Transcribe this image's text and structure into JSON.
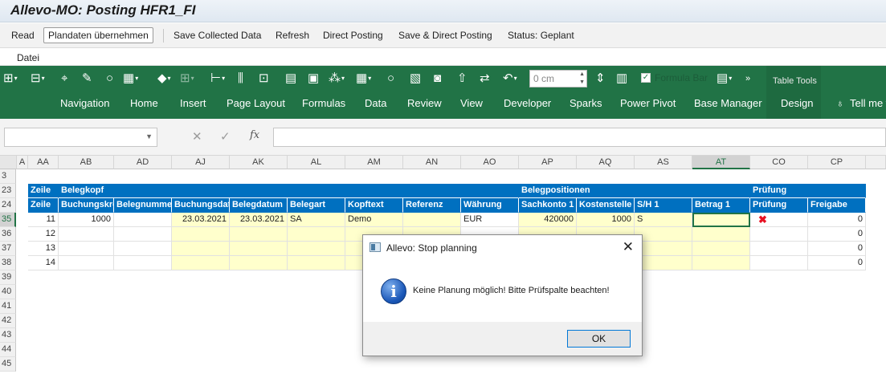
{
  "window": {
    "title": "Allevo-MO: Posting HFR1_FI"
  },
  "toolbar": {
    "items": [
      "Read",
      "Plandaten übernehmen",
      "Save Collected Data",
      "Refresh",
      "Direct Posting",
      "Save & Direct Posting",
      "Status: Geplant"
    ]
  },
  "menu": {
    "datei": "Datei"
  },
  "ribbon": {
    "zoom_value": "0 cm",
    "formula_bar_label": "Formula Bar",
    "table_tools_label": "Table Tools",
    "tabs": [
      "Navigation",
      "Home",
      "Insert",
      "Page Layout",
      "Formulas",
      "Data",
      "Review",
      "View",
      "Developer",
      "Sparks",
      "Power Pivot",
      "Base Manager",
      "Design",
      "Tell me wha"
    ]
  },
  "formula": {
    "cancel": "✕",
    "enter": "✓",
    "fx": "fx"
  },
  "grid": {
    "columns": [
      "A",
      "AA",
      "AB",
      "AD",
      "AJ",
      "AK",
      "AL",
      "AM",
      "AN",
      "AO",
      "AP",
      "AQ",
      "AS",
      "AT",
      "CO",
      "CP"
    ],
    "rows": [
      "3",
      "23",
      "24",
      "35",
      "36",
      "37",
      "38",
      "39",
      "40",
      "41",
      "42",
      "43",
      "44",
      "45"
    ],
    "group_row": {
      "zeile": "Zeile",
      "belegkopf": "Belegkopf",
      "belegpositionen": "Belegpositionen",
      "pruefung": "Prüfung"
    },
    "header_row": [
      "Zeile",
      "Buchungskreis",
      "Belegnummer",
      "Buchungsdatum",
      "Belegdatum",
      "Belegart",
      "Kopftext",
      "Referenz",
      "Währung",
      "Sachkonto 1",
      "Kostenstelle 1",
      "S/H 1",
      "Betrag 1",
      "Prüfung",
      "Freigabe"
    ],
    "data_rows": [
      {
        "zeile": "11",
        "bukrs": "1000",
        "belnr": "",
        "budat": "23.03.2021",
        "bldat": "23.03.2021",
        "blart": "SA",
        "kopftext": "Demo",
        "referenz": "",
        "waehrung": "EUR",
        "sachkonto": "420000",
        "kostenstelle": "1000",
        "sh": "S",
        "betrag": "",
        "pruefung": "✖",
        "freigabe": "0"
      },
      {
        "zeile": "12",
        "freigabe": "0"
      },
      {
        "zeile": "13",
        "freigabe": "0"
      },
      {
        "zeile": "14",
        "freigabe": "0"
      }
    ]
  },
  "dialog": {
    "title": "Allevo: Stop planning",
    "message": "Keine Planung möglich! Bitte Prüfspalte beachten!",
    "ok_label": "OK",
    "close_glyph": "✕",
    "icon": "info-icon"
  }
}
